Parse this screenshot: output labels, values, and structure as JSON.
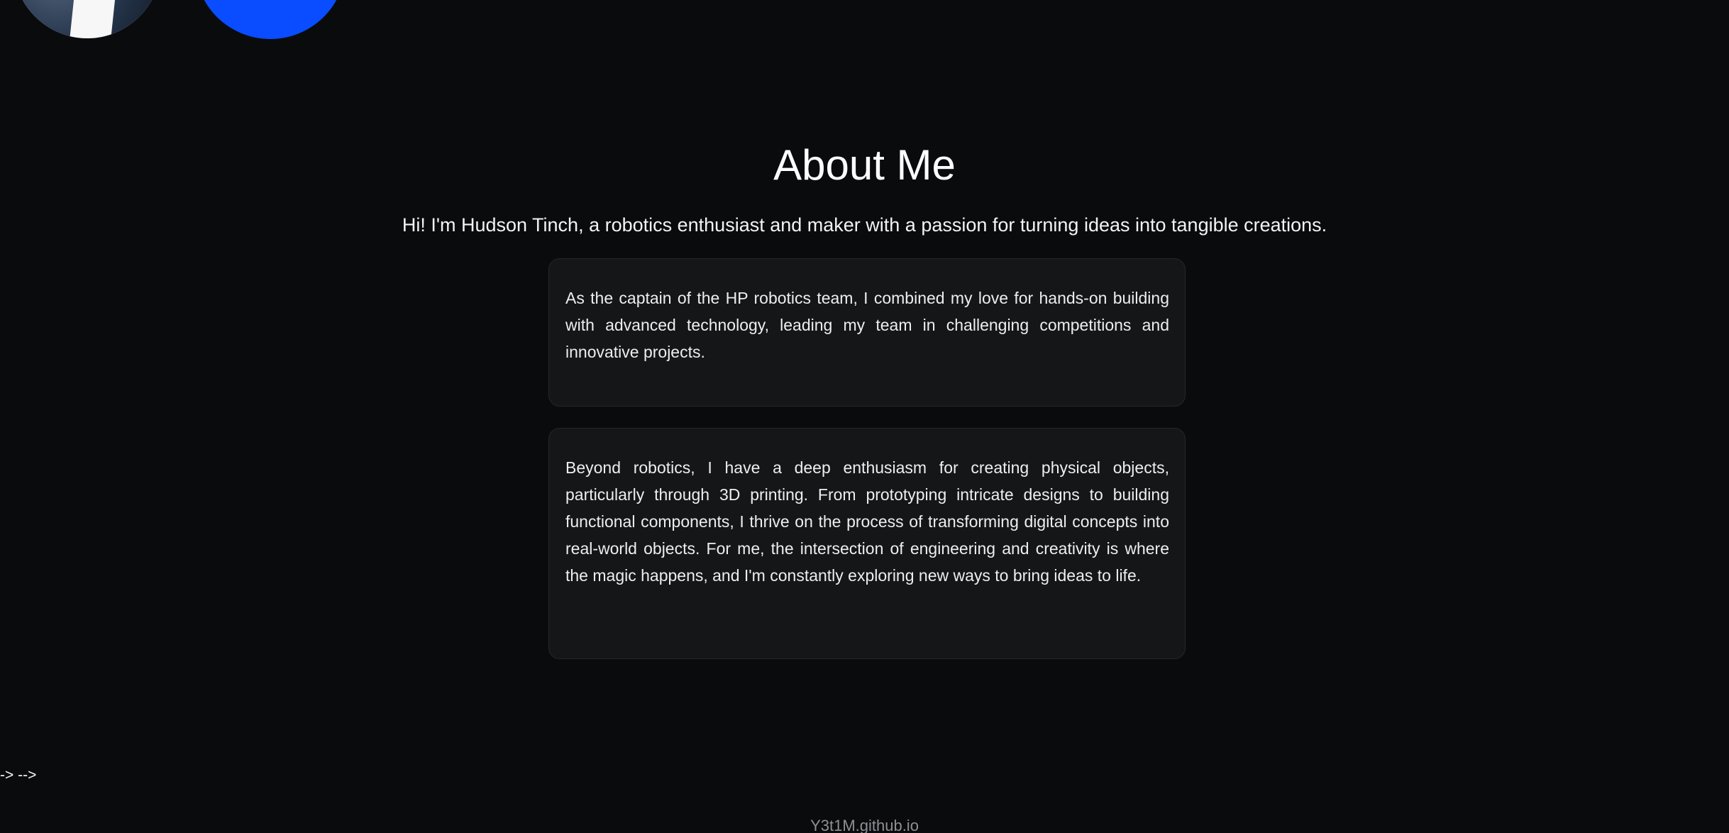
{
  "header": {
    "avatar_image": "profile-photo",
    "brand_circle_color": "#0a4cff"
  },
  "about": {
    "title": "About Me",
    "intro": "Hi! I'm Hudson Tinch, a robotics enthusiast and maker with a passion for turning ideas into tangible creations.",
    "cards": [
      {
        "text": "As the captain of the HP robotics team, I combined my love for hands-on building with advanced technology, leading my team in challenging competitions and innovative projects."
      },
      {
        "text": "Beyond robotics, I have a deep enthusiasm for creating physical objects, particularly through 3D printing. From prototyping intricate designs to building functional components, I thrive on the process of transforming digital concepts into real-world objects. For me, the intersection of engineering and creativity is where the magic happens, and I'm constantly exploring new ways to bring ideas to life."
      }
    ]
  },
  "artifacts": {
    "comment_text": "-> -->"
  },
  "footer": {
    "text": "Y3t1M.github.io"
  },
  "colors": {
    "background": "#0a0b0d",
    "card": "#151618",
    "text": "#f2f3f5",
    "footer_text": "#8c8f94"
  }
}
